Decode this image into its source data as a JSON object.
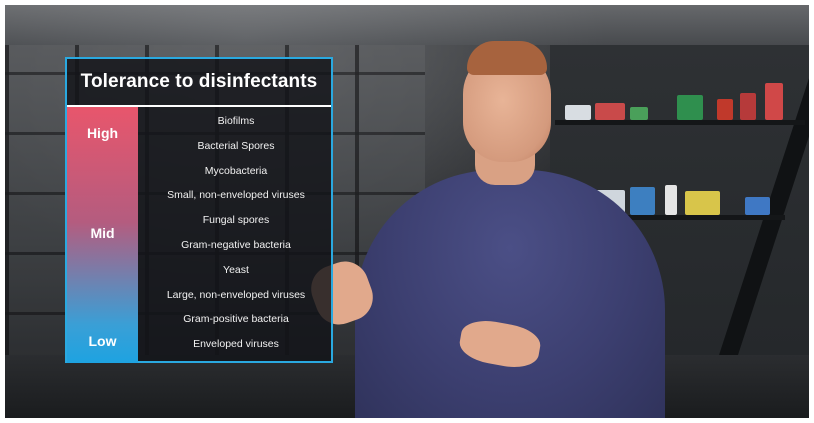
{
  "panel": {
    "title": "Tolerance to disinfectants",
    "scale": {
      "high": "High",
      "mid": "Mid",
      "low": "Low"
    },
    "items": [
      "Biofilms",
      "Bacterial Spores",
      "Mycobacteria",
      "Small, non-enveloped viruses",
      "Fungal spores",
      "Gram-negative bacteria",
      "Yeast",
      "Large, non-enveloped viruses",
      "Gram-positive bacteria",
      "Enveloped viruses"
    ]
  },
  "colors": {
    "border_accent": "#2aa9e0",
    "scale_high": "#e8566c",
    "scale_low": "#1ea3e1"
  }
}
